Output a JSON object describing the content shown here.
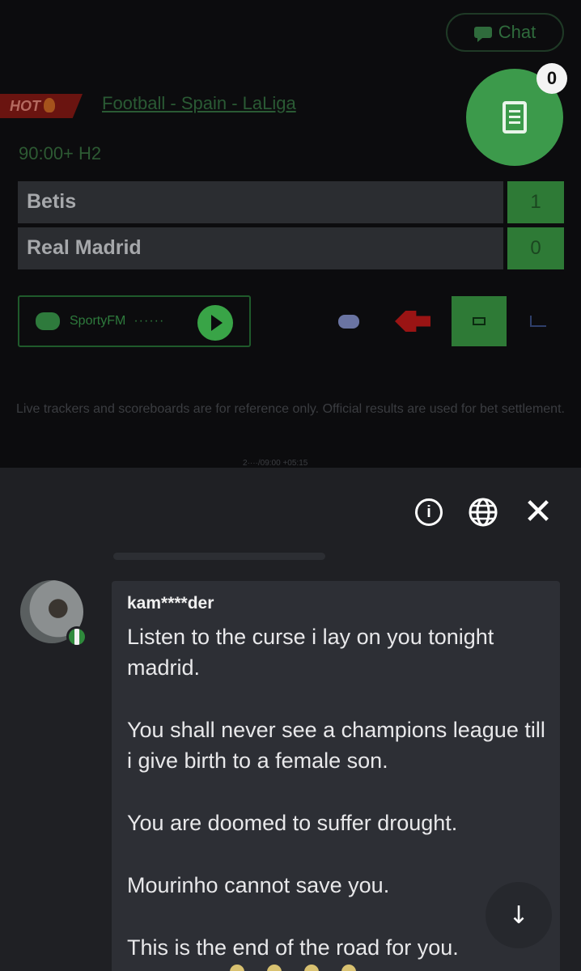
{
  "header": {
    "chat_label": "Chat",
    "bet_slip_count": "0"
  },
  "match": {
    "hot_label": "HOT",
    "league": "Football - Spain - LaLiga",
    "clock": "90:00+ H2",
    "teams": [
      {
        "name": "Betis",
        "score": "1"
      },
      {
        "name": "Real Madrid",
        "score": "0"
      }
    ]
  },
  "radio": {
    "label": "SportyFM",
    "dots": "······"
  },
  "disclaimer": "Live trackers and scoreboards are for reference only. Official results are used for bet settlement.",
  "timestamp_faint": "2····/09:00 +05:15",
  "chat": {
    "username": "kam****der",
    "paragraphs": [
      "Listen to the curse i lay on you tonight madrid.",
      "You shall never see a champions league till i give birth to a female son.",
      "You are doomed to suffer drought.",
      "Mourinho cannot save you.",
      "This is the end of the road for you."
    ]
  },
  "icons": {
    "chat": "chat-bubble-icon",
    "bet_slip": "ticket-icon",
    "fire": "flame-icon",
    "radio_play": "play-icon",
    "controller": "gamepad-icon",
    "stream": "stream-icon",
    "tv": "tv-icon",
    "stats": "stats-icon",
    "info": "info-icon",
    "globe": "globe-icon",
    "close": "close-icon",
    "scroll": "arrow-down-icon"
  },
  "colors": {
    "accent_green": "#3c9a4b",
    "hot_red": "#6a1410",
    "flag_green": "#2f8a3c"
  }
}
